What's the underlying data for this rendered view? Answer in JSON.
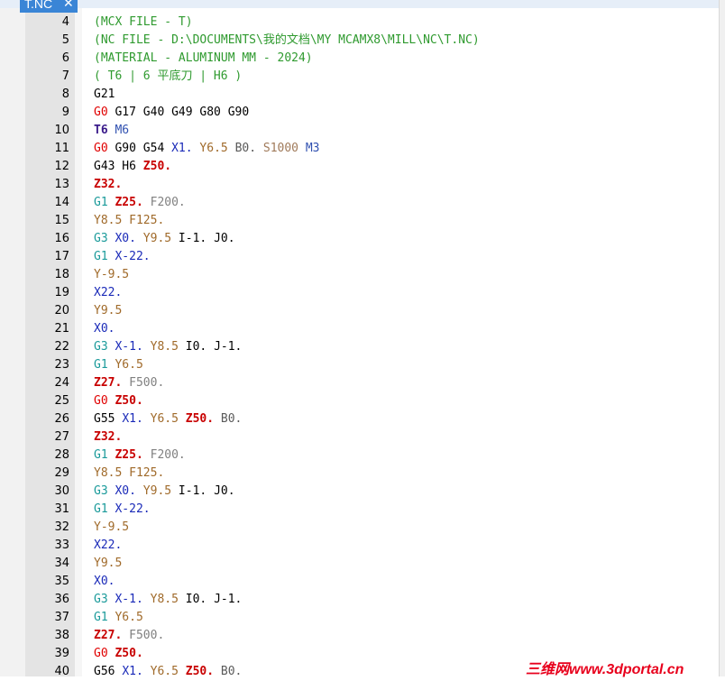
{
  "tab": {
    "title": "T.NC",
    "close_glyph": "✕"
  },
  "colors": {
    "comment": "#2f9a2f",
    "g0": "#e00000",
    "gcyan": "#1a9a9a",
    "tcode": "#3a1a8a",
    "mcode": "#3050b0",
    "x": "#1a2ab8",
    "y": "#a06a2a",
    "z": "#c80000",
    "feed": "#808080",
    "b": "#5a5a5a",
    "s": "#a07a5a",
    "plain": "#000000"
  },
  "lines": [
    {
      "n": "4",
      "tokens": [
        {
          "t": "(MCX FILE - T)",
          "c": "comment"
        }
      ]
    },
    {
      "n": "5",
      "tokens": [
        {
          "t": "(NC FILE - D:\\DOCUMENTS\\我的文档\\MY MCAMX8\\MILL\\NC\\T.NC)",
          "c": "comment"
        }
      ]
    },
    {
      "n": "6",
      "tokens": [
        {
          "t": "(MATERIAL - ALUMINUM MM - 2024)",
          "c": "comment"
        }
      ]
    },
    {
      "n": "7",
      "tokens": [
        {
          "t": "( T6 | 6 平底刀 | H6 )",
          "c": "comment"
        }
      ]
    },
    {
      "n": "8",
      "tokens": [
        {
          "t": "G21",
          "c": "plain"
        }
      ]
    },
    {
      "n": "9",
      "tokens": [
        {
          "t": "G0",
          "c": "g0"
        },
        {
          "t": " G17 G40 G49 G80 G90",
          "c": "plain"
        }
      ]
    },
    {
      "n": "10",
      "tokens": [
        {
          "t": "T6",
          "c": "tcode",
          "b": true
        },
        {
          "t": " ",
          "c": "plain"
        },
        {
          "t": "M6",
          "c": "mcode"
        }
      ]
    },
    {
      "n": "11",
      "tokens": [
        {
          "t": "G0",
          "c": "g0"
        },
        {
          "t": " G90 G54 ",
          "c": "plain"
        },
        {
          "t": "X1.",
          "c": "x"
        },
        {
          "t": " ",
          "c": "plain"
        },
        {
          "t": "Y6.5",
          "c": "y"
        },
        {
          "t": " ",
          "c": "plain"
        },
        {
          "t": "B0.",
          "c": "b"
        },
        {
          "t": " ",
          "c": "plain"
        },
        {
          "t": "S1000",
          "c": "s"
        },
        {
          "t": " ",
          "c": "plain"
        },
        {
          "t": "M3",
          "c": "mcode"
        }
      ]
    },
    {
      "n": "12",
      "tokens": [
        {
          "t": "G43 H6 ",
          "c": "plain"
        },
        {
          "t": "Z50.",
          "c": "z",
          "b": true
        }
      ]
    },
    {
      "n": "13",
      "tokens": [
        {
          "t": "Z32.",
          "c": "z",
          "b": true
        }
      ]
    },
    {
      "n": "14",
      "tokens": [
        {
          "t": "G1",
          "c": "gcyan"
        },
        {
          "t": " ",
          "c": "plain"
        },
        {
          "t": "Z25.",
          "c": "z",
          "b": true
        },
        {
          "t": " ",
          "c": "plain"
        },
        {
          "t": "F200.",
          "c": "feed"
        }
      ]
    },
    {
      "n": "15",
      "tokens": [
        {
          "t": "Y8.5",
          "c": "y"
        },
        {
          "t": " ",
          "c": "plain"
        },
        {
          "t": "F125.",
          "c": "y"
        }
      ]
    },
    {
      "n": "16",
      "tokens": [
        {
          "t": "G3",
          "c": "gcyan"
        },
        {
          "t": " ",
          "c": "plain"
        },
        {
          "t": "X0.",
          "c": "x"
        },
        {
          "t": " ",
          "c": "plain"
        },
        {
          "t": "Y9.5",
          "c": "y"
        },
        {
          "t": " I-1. J0.",
          "c": "plain"
        }
      ]
    },
    {
      "n": "17",
      "tokens": [
        {
          "t": "G1",
          "c": "gcyan"
        },
        {
          "t": " ",
          "c": "plain"
        },
        {
          "t": "X-22.",
          "c": "x"
        }
      ]
    },
    {
      "n": "18",
      "tokens": [
        {
          "t": "Y-9.5",
          "c": "y"
        }
      ]
    },
    {
      "n": "19",
      "tokens": [
        {
          "t": "X22.",
          "c": "x"
        }
      ]
    },
    {
      "n": "20",
      "tokens": [
        {
          "t": "Y9.5",
          "c": "y"
        }
      ]
    },
    {
      "n": "21",
      "tokens": [
        {
          "t": "X0.",
          "c": "x"
        }
      ]
    },
    {
      "n": "22",
      "tokens": [
        {
          "t": "G3",
          "c": "gcyan"
        },
        {
          "t": " ",
          "c": "plain"
        },
        {
          "t": "X-1.",
          "c": "x"
        },
        {
          "t": " ",
          "c": "plain"
        },
        {
          "t": "Y8.5",
          "c": "y"
        },
        {
          "t": " I0. J-1.",
          "c": "plain"
        }
      ]
    },
    {
      "n": "23",
      "tokens": [
        {
          "t": "G1",
          "c": "gcyan"
        },
        {
          "t": " ",
          "c": "plain"
        },
        {
          "t": "Y6.5",
          "c": "y"
        }
      ]
    },
    {
      "n": "24",
      "tokens": [
        {
          "t": "Z27.",
          "c": "z",
          "b": true
        },
        {
          "t": " ",
          "c": "plain"
        },
        {
          "t": "F500.",
          "c": "feed"
        }
      ]
    },
    {
      "n": "25",
      "tokens": [
        {
          "t": "G0",
          "c": "g0"
        },
        {
          "t": " ",
          "c": "plain"
        },
        {
          "t": "Z50.",
          "c": "z",
          "b": true
        }
      ]
    },
    {
      "n": "26",
      "tokens": [
        {
          "t": "G55 ",
          "c": "plain"
        },
        {
          "t": "X1.",
          "c": "x"
        },
        {
          "t": " ",
          "c": "plain"
        },
        {
          "t": "Y6.5",
          "c": "y"
        },
        {
          "t": " ",
          "c": "plain"
        },
        {
          "t": "Z50.",
          "c": "z",
          "b": true
        },
        {
          "t": " ",
          "c": "plain"
        },
        {
          "t": "B0.",
          "c": "b"
        }
      ]
    },
    {
      "n": "27",
      "tokens": [
        {
          "t": "Z32.",
          "c": "z",
          "b": true
        }
      ]
    },
    {
      "n": "28",
      "tokens": [
        {
          "t": "G1",
          "c": "gcyan"
        },
        {
          "t": " ",
          "c": "plain"
        },
        {
          "t": "Z25.",
          "c": "z",
          "b": true
        },
        {
          "t": " ",
          "c": "plain"
        },
        {
          "t": "F200.",
          "c": "feed"
        }
      ]
    },
    {
      "n": "29",
      "tokens": [
        {
          "t": "Y8.5",
          "c": "y"
        },
        {
          "t": " ",
          "c": "plain"
        },
        {
          "t": "F125.",
          "c": "y"
        }
      ]
    },
    {
      "n": "30",
      "tokens": [
        {
          "t": "G3",
          "c": "gcyan"
        },
        {
          "t": " ",
          "c": "plain"
        },
        {
          "t": "X0.",
          "c": "x"
        },
        {
          "t": " ",
          "c": "plain"
        },
        {
          "t": "Y9.5",
          "c": "y"
        },
        {
          "t": " I-1. J0.",
          "c": "plain"
        }
      ]
    },
    {
      "n": "31",
      "tokens": [
        {
          "t": "G1",
          "c": "gcyan"
        },
        {
          "t": " ",
          "c": "plain"
        },
        {
          "t": "X-22.",
          "c": "x"
        }
      ]
    },
    {
      "n": "32",
      "tokens": [
        {
          "t": "Y-9.5",
          "c": "y"
        }
      ]
    },
    {
      "n": "33",
      "tokens": [
        {
          "t": "X22.",
          "c": "x"
        }
      ]
    },
    {
      "n": "34",
      "tokens": [
        {
          "t": "Y9.5",
          "c": "y"
        }
      ]
    },
    {
      "n": "35",
      "tokens": [
        {
          "t": "X0.",
          "c": "x"
        }
      ]
    },
    {
      "n": "36",
      "tokens": [
        {
          "t": "G3",
          "c": "gcyan"
        },
        {
          "t": " ",
          "c": "plain"
        },
        {
          "t": "X-1.",
          "c": "x"
        },
        {
          "t": " ",
          "c": "plain"
        },
        {
          "t": "Y8.5",
          "c": "y"
        },
        {
          "t": " I0. J-1.",
          "c": "plain"
        }
      ]
    },
    {
      "n": "37",
      "tokens": [
        {
          "t": "G1",
          "c": "gcyan"
        },
        {
          "t": " ",
          "c": "plain"
        },
        {
          "t": "Y6.5",
          "c": "y"
        }
      ]
    },
    {
      "n": "38",
      "tokens": [
        {
          "t": "Z27.",
          "c": "z",
          "b": true
        },
        {
          "t": " ",
          "c": "plain"
        },
        {
          "t": "F500.",
          "c": "feed"
        }
      ]
    },
    {
      "n": "39",
      "tokens": [
        {
          "t": "G0",
          "c": "g0"
        },
        {
          "t": " ",
          "c": "plain"
        },
        {
          "t": "Z50.",
          "c": "z",
          "b": true
        }
      ]
    },
    {
      "n": "40",
      "tokens": [
        {
          "t": "G56 ",
          "c": "plain"
        },
        {
          "t": "X1.",
          "c": "x"
        },
        {
          "t": " ",
          "c": "plain"
        },
        {
          "t": "Y6.5",
          "c": "y"
        },
        {
          "t": " ",
          "c": "plain"
        },
        {
          "t": "Z50.",
          "c": "z",
          "b": true
        },
        {
          "t": " ",
          "c": "plain"
        },
        {
          "t": "B0.",
          "c": "b"
        }
      ]
    }
  ],
  "watermark": "三维网www.3dportal.cn"
}
